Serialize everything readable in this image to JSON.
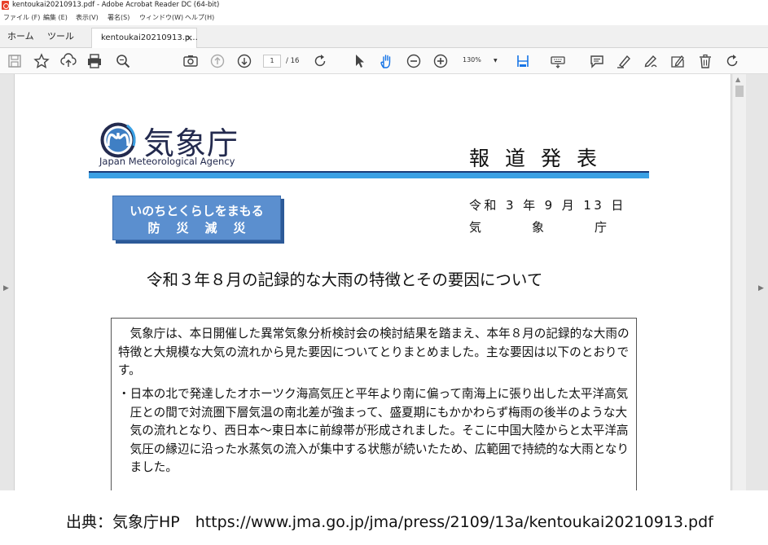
{
  "window": {
    "title": "kentoukai20210913.pdf - Adobe Acrobat Reader DC (64-bit)",
    "icon": "pdf-file-icon"
  },
  "menubar": [
    "ファイル (F)",
    "編集 (E)",
    "表示(V)",
    "署名(S)",
    "ウィンドウ(W)",
    "ヘルプ(H)"
  ],
  "tabs": {
    "home": "ホーム",
    "tools": "ツール",
    "document": "kentoukai20210913.p...",
    "close": "×"
  },
  "toolbar": {
    "icons": [
      "save-icon",
      "bookmark-star-icon",
      "upload-icon",
      "print-icon",
      "search-icon",
      "snapshot-icon",
      "page-up-icon",
      "page-down-icon",
      "rotate-icon",
      "select-cursor-icon",
      "hand-icon",
      "zoom-out-icon",
      "zoom-in-icon",
      "fit-page-icon",
      "keyboard-icon",
      "comment-icon",
      "highlight-icon",
      "sign-icon",
      "edit-icon",
      "delete-icon",
      "redo-icon"
    ],
    "page_current": "1",
    "page_total": "/ 16",
    "zoom": "130%",
    "zoom_arrow": "▼"
  },
  "document": {
    "agency_name": "気象庁",
    "agency_english": "Japan Meteorological Agency",
    "release_label": "報道発表",
    "slogan_line1": "いのちとくらしをまもる",
    "slogan_line2": "防災減災",
    "date": "令和 3 年 9 月 13 日",
    "issuer": "気象庁",
    "heading": "令和３年８月の記録的な大雨の特徴とその要因について",
    "summary_intro": "気象庁は、本日開催した異常気象分析検討会の検討結果を踏まえ、本年８月の記録的な大雨の特徴と大規模な大気の流れから見た要因についてとりまとめました。主な要因は以下のとおりです。",
    "summary_bullet": "・日本の北で発達したオホーツク海高気圧と平年より南に偏って南海上に張り出した太平洋高気圧との間で対流圏下層気温の南北差が強まって、盛夏期にもかかわらず梅雨の後半のような大気の流れとなり、西日本～東日本に前線帯が形成されました。そこに中国大陸からと太平洋高気圧の縁辺に沿った水蒸気の流入が集中する状態が続いたため、広範囲で持続的な大雨となりました。"
  },
  "caption": "出典：気象庁HP　https://www.jma.go.jp/jma/press/2109/13a/kentoukai20210913.pdf",
  "colors": {
    "rule_dark": "#1a3b78",
    "rule_light": "#3aa0e4",
    "slogan_bg": "#5b8fcf",
    "agency_text": "#232a4e",
    "acrobat_accent": "#1473e6"
  }
}
